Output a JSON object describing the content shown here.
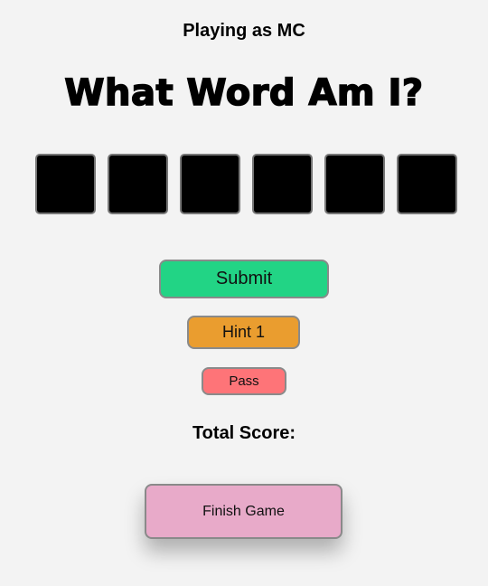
{
  "header": {
    "player_text": "Playing as MC",
    "title": "What Word Am I?"
  },
  "word_tiles": {
    "count": 6,
    "color": "#000000"
  },
  "buttons": {
    "submit_label": "Submit",
    "hint_label": "Hint 1",
    "pass_label": "Pass",
    "finish_label": "Finish Game"
  },
  "score": {
    "label": "Total Score:"
  },
  "colors": {
    "background": "#f3f3f3",
    "submit": "#22d485",
    "hint": "#ea9d2f",
    "pass": "#fe7478",
    "finish": "#e8aac9"
  }
}
